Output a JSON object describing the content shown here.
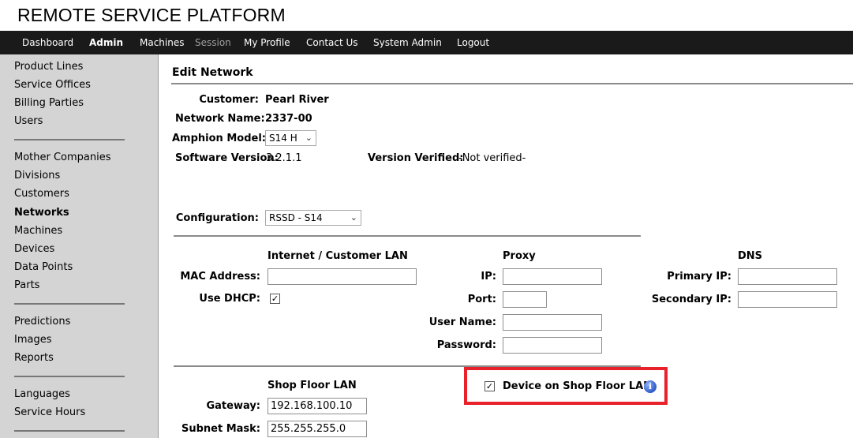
{
  "app": {
    "title": "REMOTE SERVICE PLATFORM"
  },
  "topnav": {
    "items": [
      {
        "label": "Dashboard"
      },
      {
        "label": "Admin"
      },
      {
        "label": "Machines"
      },
      {
        "label": "Session"
      },
      {
        "label": "My Profile"
      },
      {
        "label": "Contact Us"
      },
      {
        "label": "System Admin"
      },
      {
        "label": "Logout"
      }
    ],
    "active": "Admin"
  },
  "sidebar": {
    "group1": [
      "Product Lines",
      "Service Offices",
      "Billing Parties",
      "Users"
    ],
    "group2": [
      "Mother Companies",
      "Divisions",
      "Customers",
      "Networks",
      "Machines",
      "Devices",
      "Data Points",
      "Parts"
    ],
    "group3": [
      "Predictions",
      "Images",
      "Reports"
    ],
    "group4": [
      "Languages",
      "Service Hours"
    ],
    "active": "Networks"
  },
  "page": {
    "heading": "Edit Network",
    "customer_label": "Customer:",
    "customer_value": "Pearl River",
    "network_name_label": "Network Name:",
    "network_name_value": "2337-00",
    "amphion_model_label": "Amphion Model:",
    "amphion_model_value": "S14 H",
    "software_version_label": "Software Version:",
    "software_version_value": "3.2.1.1",
    "version_verified_label": "Version Verified:",
    "version_verified_value": "-Not verified-",
    "configuration_label": "Configuration:",
    "configuration_value": "RSSD - S14"
  },
  "internet_lan": {
    "heading": "Internet / Customer LAN",
    "mac_label": "MAC Address:",
    "mac_value": "",
    "dhcp_label": "Use DHCP:",
    "dhcp_checked": true
  },
  "proxy": {
    "heading": "Proxy",
    "ip_label": "IP:",
    "ip_value": "",
    "port_label": "Port:",
    "port_value": "",
    "username_label": "User Name:",
    "username_value": "",
    "password_label": "Password:",
    "password_value": ""
  },
  "dns": {
    "heading": "DNS",
    "primary_label": "Primary IP:",
    "primary_value": "",
    "secondary_label": "Secondary IP:",
    "secondary_value": ""
  },
  "shop_floor": {
    "heading": "Shop Floor LAN",
    "gateway_label": "Gateway:",
    "gateway_value": "192.168.100.10",
    "subnet_label": "Subnet Mask:",
    "subnet_value": "255.255.255.0",
    "device_on_lan_label": "Device on Shop Floor LAN",
    "device_on_lan_checked": true
  },
  "icons": {
    "checkmark": "✓",
    "chevron": "⌄",
    "info": "i"
  },
  "colors": {
    "nav_bg": "#1a1a1a",
    "sidebar_bg": "#d4d4d4",
    "highlight": "#e8212a",
    "info_icon": "#2d59c8"
  }
}
